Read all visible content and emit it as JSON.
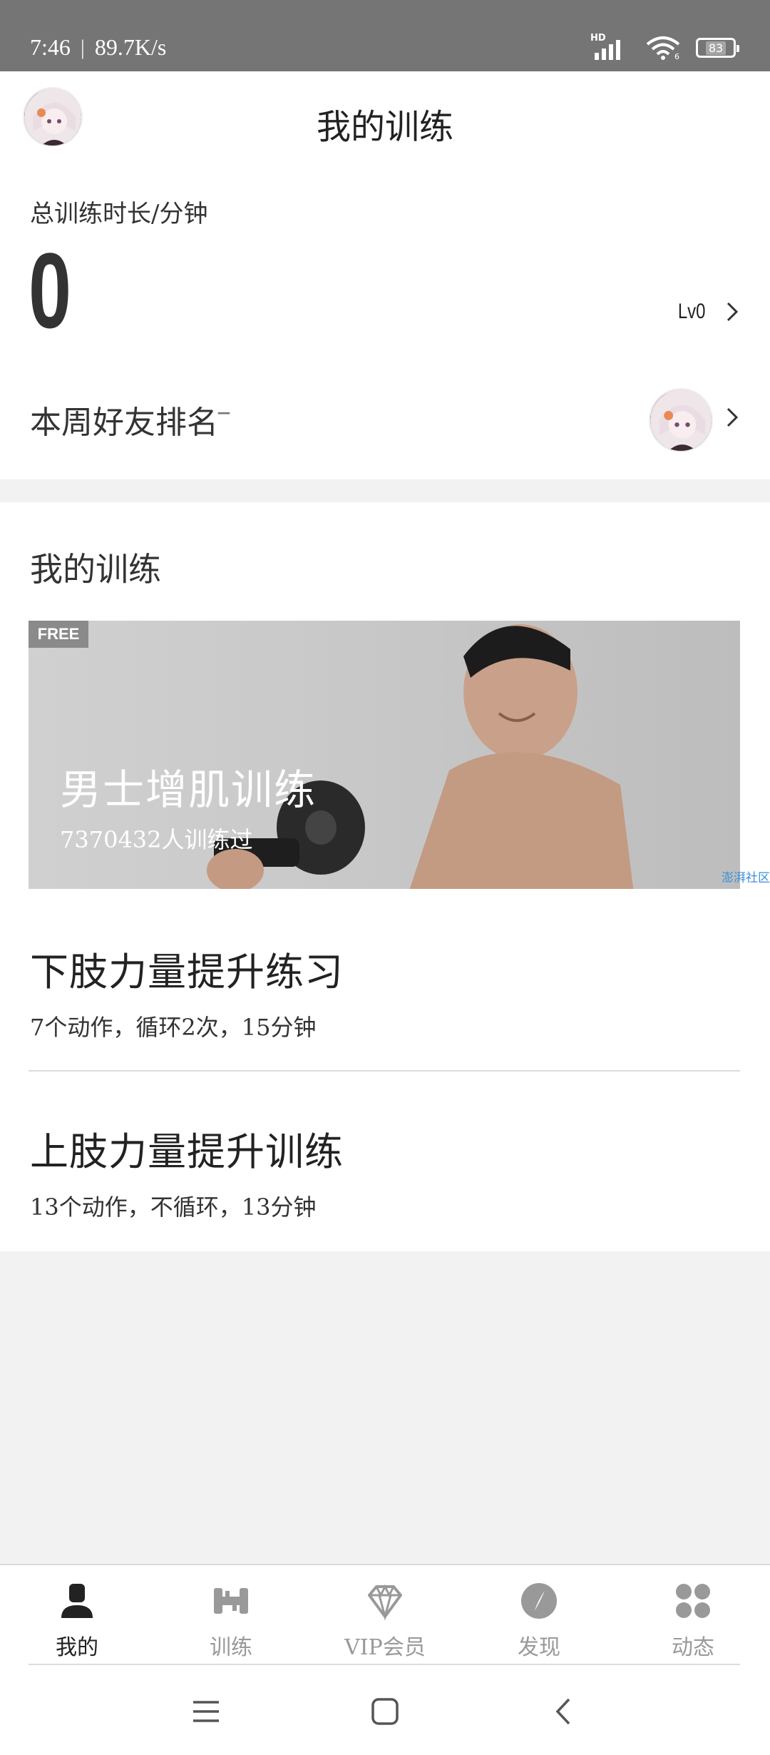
{
  "status_bar": {
    "time": "7:46",
    "separator": "|",
    "net_speed": "89.7K/s",
    "hd": "HD",
    "wifi_sub": "6",
    "battery": "83"
  },
  "header": {
    "title": "我的训练"
  },
  "stats": {
    "total_label": "总训练时长/分钟",
    "total_value": "0",
    "level": "Lv0",
    "friends_label": "本周好友排名",
    "friends_rank": "–"
  },
  "training": {
    "section_title": "我的训练",
    "featured": {
      "tag": "FREE",
      "title": "男士增肌训练",
      "subtitle": "7370432人训练过",
      "watermark": "澎湃社区"
    },
    "programs": [
      {
        "title": "下肢力量提升练习",
        "detail": "7个动作，循环2次，15分钟"
      },
      {
        "title": "上肢力量提升训练",
        "detail": "13个动作，不循环，13分钟"
      }
    ]
  },
  "nav": {
    "items": [
      {
        "label": "我的",
        "icon": "person-icon",
        "active": true
      },
      {
        "label": "训练",
        "icon": "dumbbell-icon",
        "active": false
      },
      {
        "label": "VIP会员",
        "icon": "diamond-icon",
        "active": false
      },
      {
        "label": "发现",
        "icon": "compass-icon",
        "active": false
      },
      {
        "label": "动态",
        "icon": "dots-icon",
        "active": false
      }
    ]
  },
  "colors": {
    "status_bar": "#757575",
    "nav_active": "#222222",
    "nav_inactive": "#999999",
    "watermark": "#3b8fd8"
  }
}
